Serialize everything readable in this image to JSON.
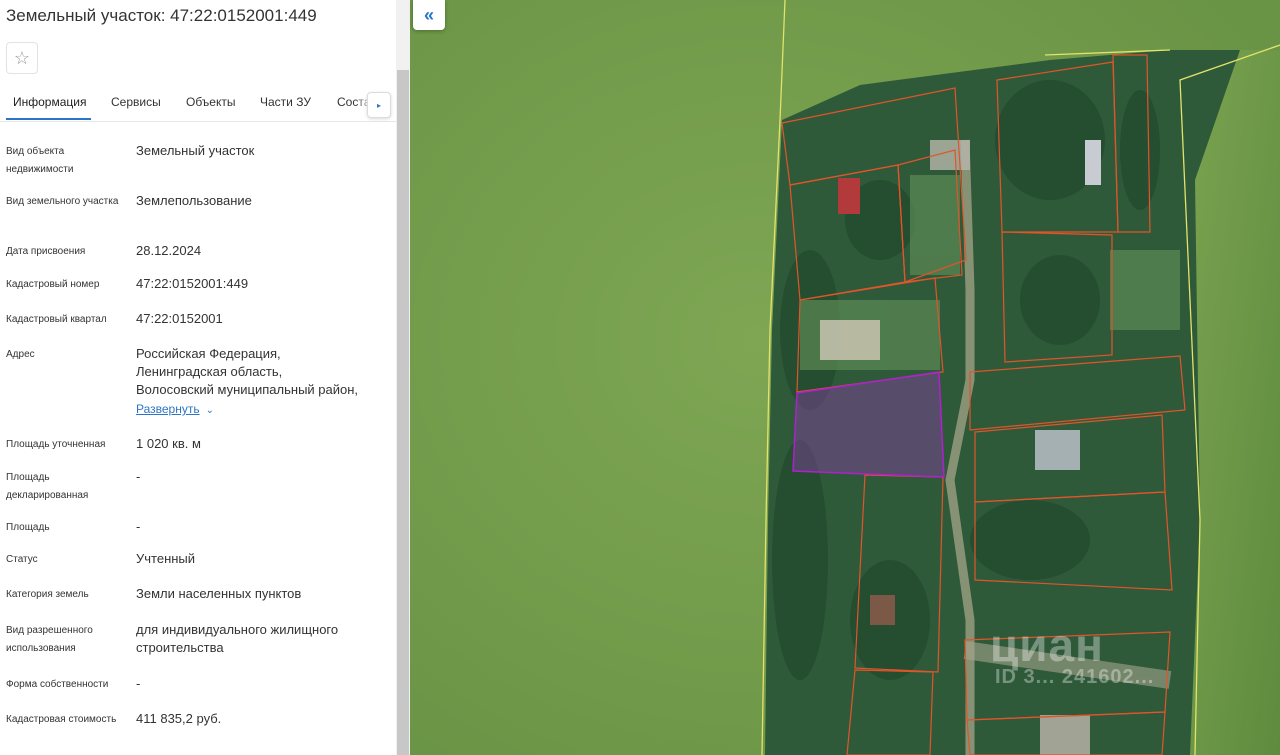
{
  "header": {
    "title": "Земельный участок: 47:22:0152001:449"
  },
  "favorite": {
    "icon": "star-icon",
    "glyph": "☆"
  },
  "tabs": [
    {
      "label": "Информация",
      "active": true
    },
    {
      "label": "Сервисы"
    },
    {
      "label": "Объекты"
    },
    {
      "label": "Части ЗУ"
    },
    {
      "label": "Состав"
    }
  ],
  "tabs_scroll": {
    "icon": "chevron-right-icon",
    "glyph": "▸"
  },
  "fields": [
    {
      "label": "Вид объекта недвижимости",
      "value": "Земельный участок"
    },
    {
      "label": "Вид земельного участка",
      "value": "Землепользование"
    },
    {
      "label": "Дата присвоения",
      "value": "28.12.2024"
    },
    {
      "label": "Кадастровый номер",
      "value": "47:22:0152001:449"
    },
    {
      "label": "Кадастровый квартал",
      "value": "47:22:0152001"
    },
    {
      "label": "Адрес",
      "value_lines": [
        "Российская Федерация,",
        "Ленинградская область,",
        "Волосовский муниципальный район,"
      ],
      "expand_label": "Развернуть"
    },
    {
      "label": "Площадь уточненная",
      "value": "1 020 кв. м"
    },
    {
      "label": "Площадь декларированная",
      "value": "-"
    },
    {
      "label": "Площадь",
      "value": "-"
    },
    {
      "label": "Статус",
      "value": "Учтенный"
    },
    {
      "label": "Категория земель",
      "value": "Земли населенных пунктов"
    },
    {
      "label": "Вид разрешенного использования",
      "value": "для индивидуального жилищного строительства"
    },
    {
      "label": "Форма собственности",
      "value": "-"
    },
    {
      "label": "Кадастровая стоимость",
      "value": "411 835,2 руб."
    }
  ],
  "map": {
    "collapse_icon": "double-chevron-left-icon",
    "collapse_glyph": "«",
    "parcel_border_color": "#e0552b",
    "selected_parcel_color": "#b01fd0",
    "boundary_color": "#e3e26a",
    "watermark": {
      "brand": "циан",
      "id": "ID 3... 241602..."
    }
  }
}
